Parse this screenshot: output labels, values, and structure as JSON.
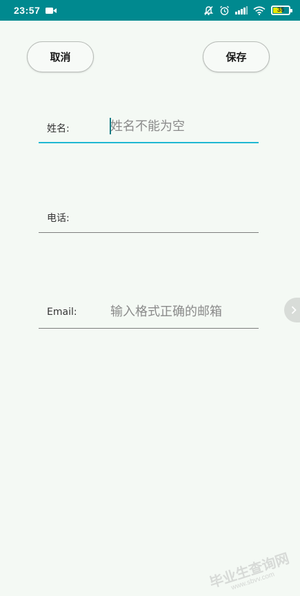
{
  "status_bar": {
    "time": "23:57",
    "battery_level": "35",
    "icons": [
      "video-camera-icon",
      "mute-bell-icon",
      "alarm-icon",
      "signal-icon",
      "wifi-icon",
      "battery-icon"
    ]
  },
  "toolbar": {
    "cancel_label": "取消",
    "save_label": "保存"
  },
  "form": {
    "name": {
      "label": "姓名:",
      "placeholder": "姓名不能为空",
      "value": ""
    },
    "phone": {
      "label": "电话:",
      "placeholder": "",
      "value": ""
    },
    "email": {
      "label": "Email:",
      "placeholder": "输入格式正确的邮箱",
      "value": ""
    }
  },
  "watermark": {
    "text": "毕业生查询网",
    "sub": "www.sbvv.com"
  },
  "colors": {
    "status_bar": "#00898f",
    "active_underline": "#1fb7d2",
    "background": "#f4f9f4"
  }
}
